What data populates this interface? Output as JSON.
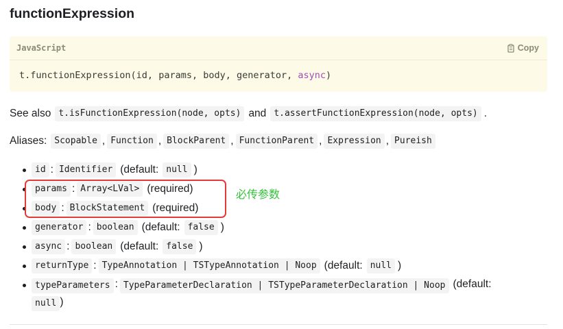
{
  "heading": "functionExpression",
  "code_block": {
    "language": "JavaScript",
    "copy_label": "Copy",
    "code_prefix": "t.functionExpression(id, params, body, generator, ",
    "code_keyword": "async",
    "code_suffix": ")"
  },
  "see_also": {
    "text_before": "See also",
    "code1": "t.isFunctionExpression(node, opts)",
    "text_and": "and",
    "code2": "t.assertFunctionExpression(node, opts)",
    "text_end": "."
  },
  "aliases": {
    "label": "Aliases:",
    "items": [
      "Scopable",
      "Function",
      "BlockParent",
      "FunctionParent",
      "Expression",
      "Pureish"
    ]
  },
  "params": [
    {
      "name": "id",
      "type": "Identifier",
      "pre": "(default:",
      "default": "null",
      "post": ")"
    },
    {
      "name": "params",
      "type": "Array<LVal>",
      "note": "(required)"
    },
    {
      "name": "body",
      "type": "BlockStatement",
      "note": "(required)"
    },
    {
      "name": "generator",
      "type": "boolean",
      "pre": "(default:",
      "default": "false",
      "post": ")"
    },
    {
      "name": "async",
      "type": "boolean",
      "pre": "(default:",
      "default": "false",
      "post": ")"
    },
    {
      "name": "returnType",
      "type": "TypeAnnotation | TSTypeAnnotation | Noop",
      "pre": "(default:",
      "default": "null",
      "post": ")"
    },
    {
      "name": "typeParameters",
      "type": "TypeParameterDeclaration | TSTypeParameterDeclaration | Noop",
      "pre": "(default:",
      "default": "null",
      "post": ")"
    }
  ],
  "annotation": {
    "text": "必传参数",
    "color": "#34c23a",
    "box_color": "#e53935"
  }
}
